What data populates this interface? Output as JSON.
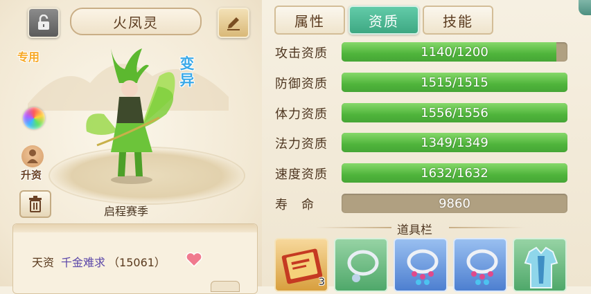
{
  "pet": {
    "name": "火凤灵",
    "exclusive_label": "专用",
    "mutation_label": "变异",
    "upgrade_label": "升资",
    "season_label": "启程赛季"
  },
  "talent": {
    "label": "天资",
    "value": "千金难求",
    "score": "（15061）"
  },
  "tabs": [
    {
      "label": "属性",
      "active": false
    },
    {
      "label": "资质",
      "active": true
    },
    {
      "label": "技能",
      "active": false
    }
  ],
  "stats": [
    {
      "label": "攻击资质",
      "text": "1140/1200",
      "fill": 0.95
    },
    {
      "label": "防御资质",
      "text": "1515/1515",
      "fill": 1.0
    },
    {
      "label": "体力资质",
      "text": "1556/1556",
      "fill": 1.0
    },
    {
      "label": "法力资质",
      "text": "1349/1349",
      "fill": 1.0
    },
    {
      "label": "速度资质",
      "text": "1632/1632",
      "fill": 1.0
    },
    {
      "label": "寿　命",
      "text": "9860",
      "fill": 0
    }
  ],
  "items_bar": {
    "title": "道具栏",
    "slots": [
      {
        "icon": "book-icon",
        "rarity": "gold",
        "count": "3"
      },
      {
        "icon": "necklace-icon",
        "rarity": "green"
      },
      {
        "icon": "necklace-icon",
        "rarity": "blue"
      },
      {
        "icon": "necklace-icon",
        "rarity": "blue"
      },
      {
        "icon": "armor-icon",
        "rarity": "green"
      }
    ]
  },
  "colors": {
    "bar_fill": "#4fb43b",
    "tab_active": "#4fb893",
    "mutation": "#3aa9e8",
    "exclusive": "#f7a825"
  }
}
